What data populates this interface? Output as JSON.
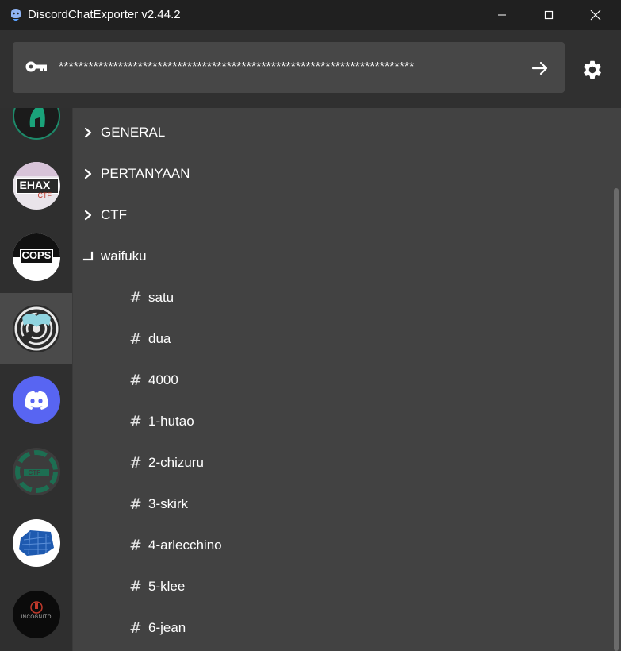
{
  "window": {
    "title": "DiscordChatExporter v2.44.2"
  },
  "toolbar": {
    "token_value": "************************************************************************",
    "token_icon": "key-icon",
    "pull_icon": "arrow-right-icon",
    "settings_icon": "gear-icon"
  },
  "guilds": [
    {
      "name": "guild-1",
      "selected": false
    },
    {
      "name": "guild-ehax",
      "avatar_text": "EHAX",
      "avatar_sub": "CTF",
      "selected": false
    },
    {
      "name": "guild-cops",
      "avatar_text": "COPS",
      "selected": false
    },
    {
      "name": "guild-selected",
      "selected": true
    },
    {
      "name": "guild-discord",
      "selected": false
    },
    {
      "name": "guild-ctf",
      "avatar_text": "CTF",
      "selected": false
    },
    {
      "name": "guild-map",
      "selected": false
    },
    {
      "name": "guild-incognito",
      "avatar_text": "INCOGNITO",
      "selected": false
    }
  ],
  "categories": [
    {
      "label": "GENERAL",
      "expanded": false
    },
    {
      "label": "PERTANYAAN",
      "expanded": false
    },
    {
      "label": "CTF",
      "expanded": false
    },
    {
      "label": "waifuku",
      "expanded": true
    }
  ],
  "channels": [
    {
      "label": "satu"
    },
    {
      "label": "dua"
    },
    {
      "label": "4000"
    },
    {
      "label": "1-hutao"
    },
    {
      "label": "2-chizuru"
    },
    {
      "label": "3-skirk"
    },
    {
      "label": "4-arlecchino"
    },
    {
      "label": "5-klee"
    },
    {
      "label": "6-jean"
    }
  ],
  "hash_glyph": "#",
  "colors": {
    "accent": "#5865f2",
    "background": "#424242",
    "toolbar": "#303030",
    "sidebar": "#2f2f2f"
  }
}
